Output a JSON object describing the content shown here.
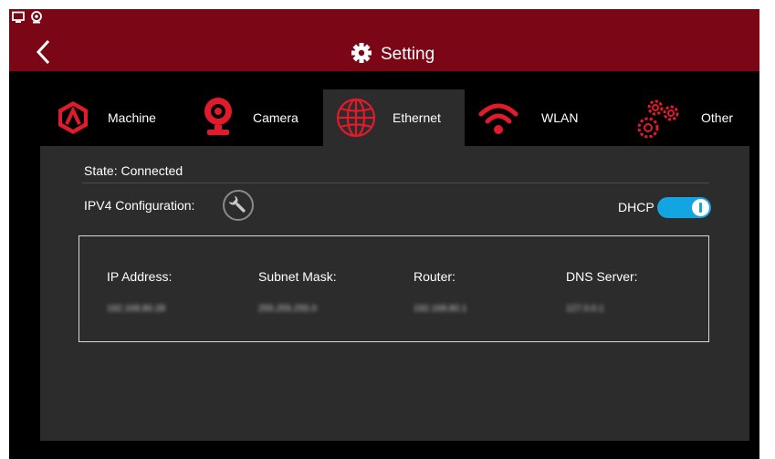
{
  "header": {
    "title": "Setting",
    "title_icon": "gear-icon",
    "back_icon": "chevron-left-icon"
  },
  "status_bar": {
    "icons": [
      "monitor-icon",
      "webcam-icon"
    ]
  },
  "tabs": [
    {
      "label": "Machine",
      "icon": "machine-logo-icon",
      "active": false
    },
    {
      "label": "Camera",
      "icon": "camera-icon",
      "active": false
    },
    {
      "label": "Ethernet",
      "icon": "globe-icon",
      "active": true
    },
    {
      "label": "WLAN",
      "icon": "wifi-icon",
      "active": false
    },
    {
      "label": "Other",
      "icon": "gears-icon",
      "active": false
    }
  ],
  "ethernet": {
    "state": "State: Connected",
    "ipv4_label": "IPV4 Configuration:",
    "dhcp_label": "DHCP",
    "dhcp_enabled": true,
    "fields": [
      {
        "label": "IP Address:",
        "value": "192.168.80.28"
      },
      {
        "label": "Subnet Mask:",
        "value": "255.255.255.0"
      },
      {
        "label": "Router:",
        "value": "192.168.80.1"
      },
      {
        "label": "DNS Server:",
        "value": "127.0.0.1"
      }
    ]
  },
  "colors": {
    "accent_red": "#e01b2b",
    "header_bg": "#7a0616",
    "panel_bg": "#2c2c2c",
    "toggle_on": "#13a5e2"
  }
}
